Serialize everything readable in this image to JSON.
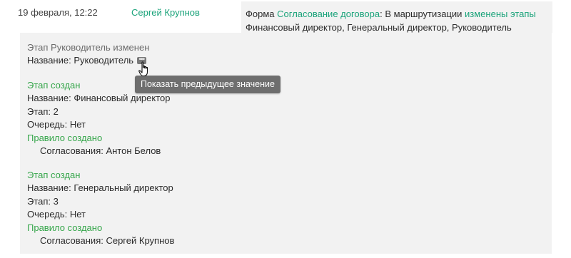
{
  "entry": {
    "date": "19 февраля, 12:22",
    "author": "Сергей Крупнов",
    "summary": {
      "prefix": "Форма ",
      "form_link": "Согласование договора",
      "middle": ": В маршрутизации ",
      "changes_link": "изменены этапы",
      "line2": "Финансовый директор, Генеральный директор, Руководитель"
    }
  },
  "changes": {
    "stage_changed": {
      "header": "Этап Руководитель изменен",
      "name": "Название: Руководитель"
    },
    "tooltip": "Показать предыдущее значение",
    "stage1": {
      "header": "Этап создан",
      "name": "Название: Финансовый директор",
      "step": "Этап: 2",
      "queue": "Очередь: Нет",
      "rule_header": "Правило создано",
      "approvals": "Согласования: Антон Белов"
    },
    "stage2": {
      "header": "Этап создан",
      "name": "Название: Генеральный директор",
      "step": "Этап: 3",
      "queue": "Очередь: Нет",
      "rule_header": "Правило создано",
      "approvals": "Согласования: Сергей Крупнов"
    }
  },
  "icons": {
    "more": "ellipsis-icon",
    "cursor": "hand-pointer-icon"
  },
  "colors": {
    "link": "#1aa37a",
    "created": "#35a64a",
    "panel": "#f2f2f2",
    "tooltip_bg": "#6e6e6e"
  }
}
